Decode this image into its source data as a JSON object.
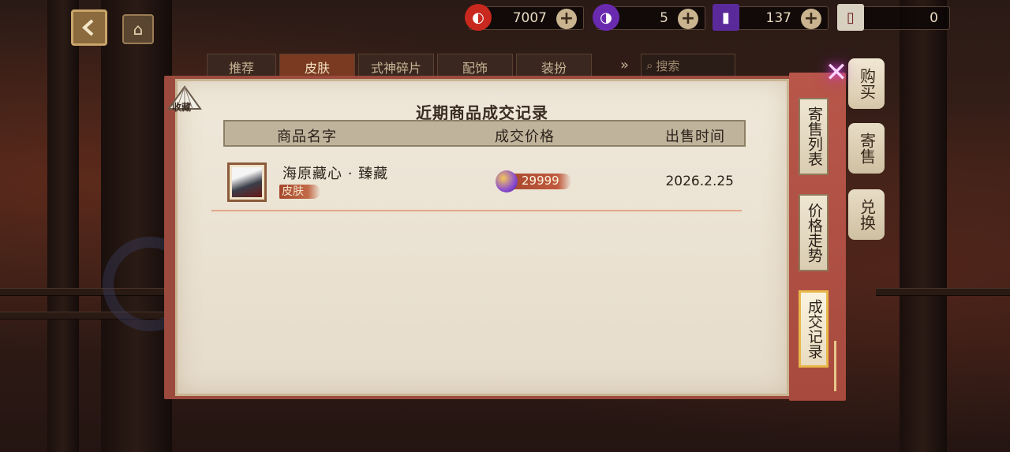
{
  "top_bar": {
    "currencies": [
      {
        "icon": "red-magatama-icon",
        "value": "7007",
        "plus": true
      },
      {
        "icon": "purple-magatama-icon",
        "value": "5",
        "plus": true
      },
      {
        "icon": "purple-ticket-icon",
        "value": "137",
        "plus": true
      },
      {
        "icon": "white-ticket-icon",
        "value": "0",
        "plus": false
      }
    ]
  },
  "tabs": [
    "推荐",
    "皮肤",
    "式神碎片",
    "配饰",
    "装扮"
  ],
  "search": {
    "placeholder": "搜索"
  },
  "side_tabs": {
    "buy": "购买",
    "consign": "寄售",
    "exchange": "兑换"
  },
  "dialog": {
    "fan_label": "收藏",
    "title": "近期商品成交记录",
    "columns": {
      "name": "商品名字",
      "price": "成交价格",
      "time": "出售时间"
    },
    "rows": [
      {
        "name": "海原藏心 · 臻藏",
        "tag": "皮肤",
        "price": "29999",
        "time": "2026.2.25"
      }
    ]
  },
  "right_tabs": {
    "list": "寄售列表",
    "trend": "价格走势",
    "records": "成交记录"
  },
  "colors": {
    "dialog_bg": "#efe8da",
    "frame_red": "#9c4a3e",
    "tag_red": "#a5472e",
    "active_gold": "#e8b84a"
  }
}
